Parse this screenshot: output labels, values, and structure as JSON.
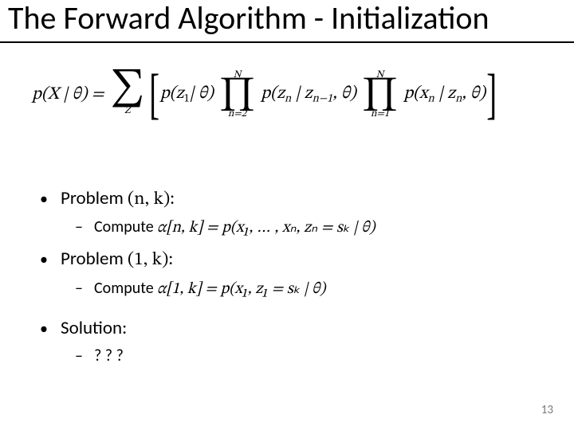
{
  "title": "The Forward Algorithm - Initialization",
  "formula": {
    "lhs": "p(X | θ) =",
    "sum_sub": "Z",
    "term1": "p(z",
    "term1_sub": "1",
    "term1_tail": "| θ)",
    "prod1_top": "N",
    "prod1_bot": "n=2",
    "term2a": "p(z",
    "term2a_sub": "n",
    "term2b": " | z",
    "term2b_sub": "n−1",
    "term2_tail": ", θ)",
    "prod2_top": "N",
    "prod2_bot": "n=1",
    "term3a": "p(x",
    "term3a_sub": "n",
    "term3b": " | z",
    "term3b_sub": "n",
    "term3_tail": ", θ)"
  },
  "items": {
    "problem_nk_label": "Problem ",
    "problem_nk_math": "(n, k):",
    "compute_nk_label": "Compute  ",
    "compute_nk_math": "α[n, k] = p(x₁, … , xₙ, zₙ = sₖ | θ)",
    "problem_1k_label": "Problem ",
    "problem_1k_math": "(1, k):",
    "compute_1k_label": "Compute ",
    "compute_1k_math": "α[1, k] = p(x₁, z₁ = sₖ | θ)",
    "solution_label": "Solution:",
    "solution_answer": "? ? ?"
  },
  "page_number": "13"
}
